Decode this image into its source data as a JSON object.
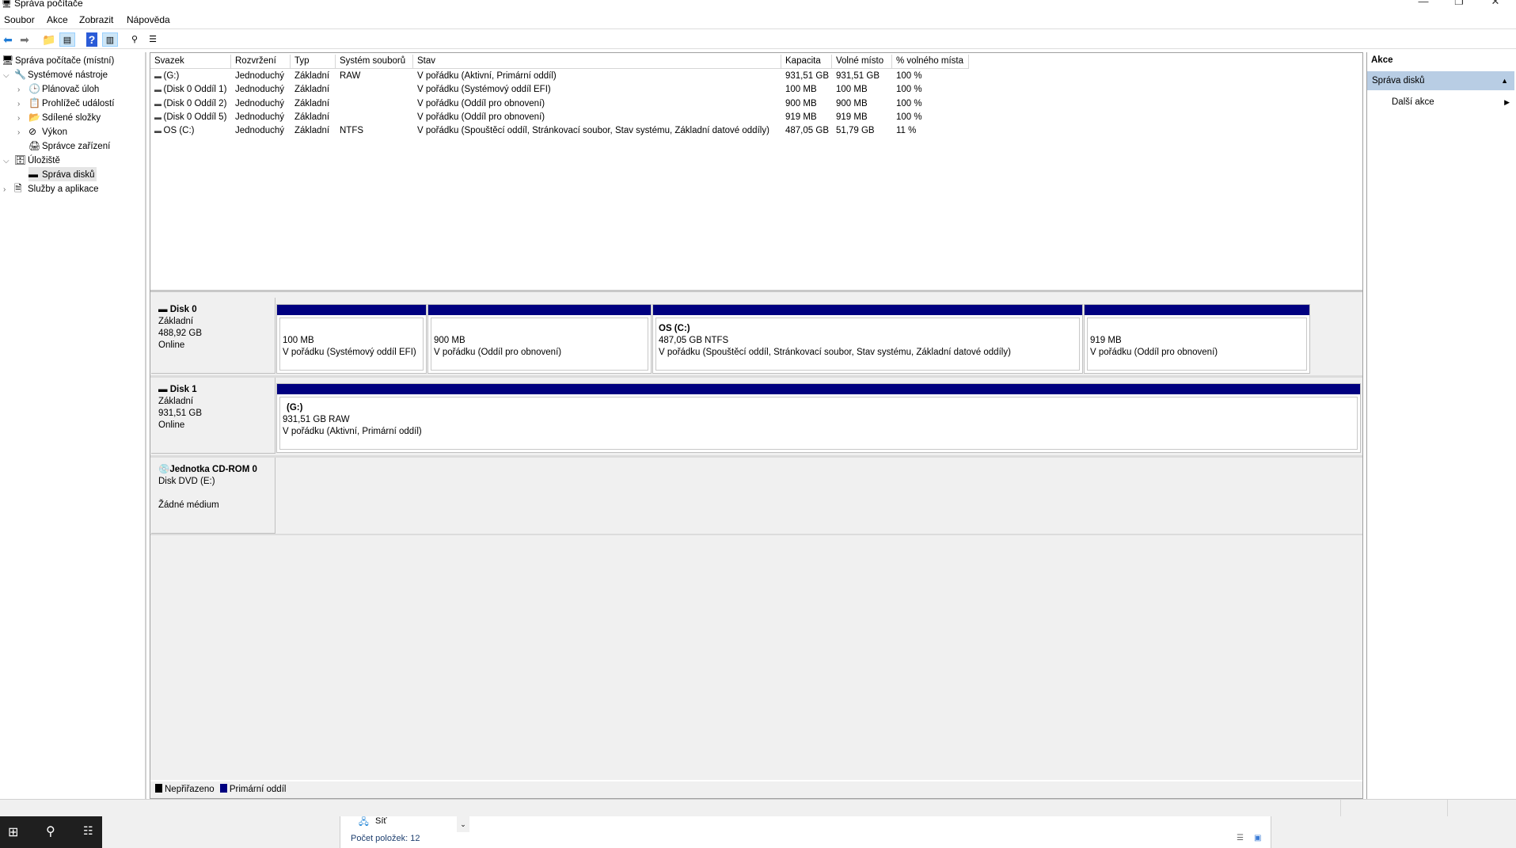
{
  "window": {
    "title": "Správa počítače",
    "minimize": "—",
    "maximize": "❐",
    "close": "✕"
  },
  "menu": [
    "Soubor",
    "Akce",
    "Zobrazit",
    "Nápověda"
  ],
  "tree": [
    {
      "label": "Správa počítače (místní)",
      "icon": "computer-management-icon"
    },
    {
      "label": "Systémové nástroje",
      "icon": "tools-icon"
    },
    {
      "label": "Plánovač úloh",
      "icon": "task-scheduler-icon"
    },
    {
      "label": "Prohlížeč událostí",
      "icon": "event-viewer-icon"
    },
    {
      "label": "Sdílené složky",
      "icon": "shared-folders-icon"
    },
    {
      "label": "Výkon",
      "icon": "performance-icon"
    },
    {
      "label": "Správce zařízení",
      "icon": "device-manager-icon"
    },
    {
      "label": "Úložiště",
      "icon": "storage-icon"
    },
    {
      "label": "Správa disků",
      "icon": "disk-management-icon"
    },
    {
      "label": "Služby a aplikace",
      "icon": "services-icon"
    }
  ],
  "table": {
    "columns": [
      "Svazek",
      "Rozvržení",
      "Typ",
      "Systém souborů",
      "Stav",
      "Kapacita",
      "Volné místo",
      "% volného místa"
    ],
    "rows": [
      [
        "(G:)",
        "Jednoduchý",
        "Základní",
        "RAW",
        "V pořádku (Aktivní, Primární oddíl)",
        "931,51 GB",
        "931,51 GB",
        "100 %"
      ],
      [
        "(Disk 0 Oddíl 1)",
        "Jednoduchý",
        "Základní",
        "",
        "V pořádku (Systémový oddíl EFI)",
        "100 MB",
        "100 MB",
        "100 %"
      ],
      [
        "(Disk 0 Oddíl 2)",
        "Jednoduchý",
        "Základní",
        "",
        "V pořádku (Oddíl pro obnovení)",
        "900 MB",
        "900 MB",
        "100 %"
      ],
      [
        "(Disk 0 Oddíl 5)",
        "Jednoduchý",
        "Základní",
        "",
        "V pořádku (Oddíl pro obnovení)",
        "919 MB",
        "919 MB",
        "100 %"
      ],
      [
        "OS (C:)",
        "Jednoduchý",
        "Základní",
        "NTFS",
        "V pořádku (Spouštěcí oddíl, Stránkovací soubor, Stav systému, Základní datové oddíly)",
        "487,05 GB",
        "51,79 GB",
        "11 %"
      ]
    ]
  },
  "disks": [
    {
      "name": "Disk 0",
      "type": "Základní",
      "size": "488,92 GB",
      "state": "Online",
      "partitions": [
        {
          "title": "",
          "size": "100 MB",
          "status": "V pořádku (Systémový oddíl EFI)"
        },
        {
          "title": "",
          "size": "900 MB",
          "status": "V pořádku (Oddíl pro obnovení)"
        },
        {
          "title": "OS  (C:)",
          "size": "487,05 GB NTFS",
          "status": "V pořádku (Spouštěcí oddíl, Stránkovací soubor, Stav systému, Základní datové oddíly)"
        },
        {
          "title": "",
          "size": "919 MB",
          "status": "V pořádku (Oddíl pro obnovení)"
        }
      ]
    },
    {
      "name": "Disk 1",
      "type": "Základní",
      "size": "931,51 GB",
      "state": "Online",
      "partitions": [
        {
          "title": "(G:)",
          "size": "931,51 GB RAW",
          "status": "V pořádku (Aktivní, Primární oddíl)"
        }
      ]
    },
    {
      "name": "Jednotka CD-ROM 0",
      "type": "Disk DVD (E:)",
      "state": "Žádné médium"
    }
  ],
  "legend": [
    {
      "label": "Nepřiřazeno",
      "color": "#000000"
    },
    {
      "label": "Primární oddíl",
      "color": "#000080"
    }
  ],
  "actions": {
    "header": "Akce",
    "section": "Správa disků",
    "item": "Další akce"
  },
  "explorer": {
    "network": "Síť",
    "count": "Počet položek: 12"
  }
}
